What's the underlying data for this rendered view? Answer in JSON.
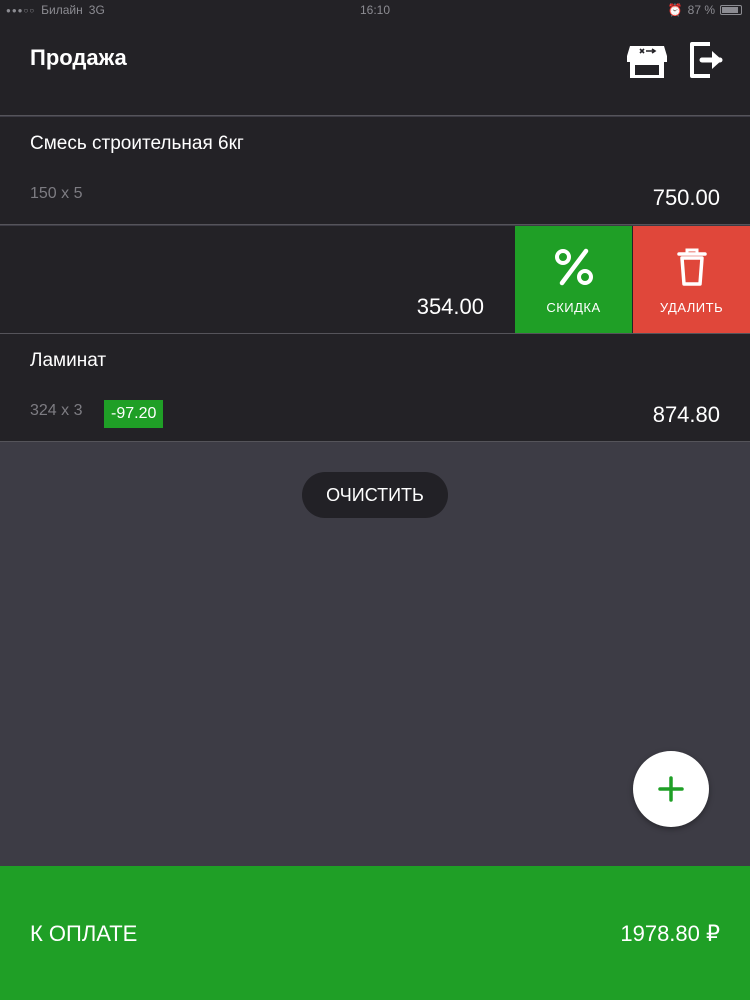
{
  "status_bar": {
    "carrier": "Билайн",
    "network": "3G",
    "time": "16:10",
    "battery": "87 %"
  },
  "header": {
    "title": "Продажа",
    "icons": [
      "store-icon",
      "logout-icon"
    ]
  },
  "items": [
    {
      "name": "Смесь строительная 6кг",
      "qty": "150 x 5",
      "discount": "",
      "total": "750.00"
    },
    {
      "name": "",
      "qty": "",
      "discount": "",
      "total": "354.00"
    },
    {
      "name": "Ламинат",
      "qty": "324 x 3",
      "discount": "-97.20",
      "total": "874.80"
    }
  ],
  "swipe_actions": {
    "discount_label": "СКИДКА",
    "delete_label": "УДАЛИТЬ"
  },
  "clear_label": "ОЧИСТИТЬ",
  "fab_icon": "plus-icon",
  "pay": {
    "label": "К ОПЛАТЕ",
    "amount": "1978.80 ₽"
  },
  "colors": {
    "background": "#3d3c45",
    "panel": "#232226",
    "accent_green": "#1f9f26",
    "delete_red": "#e0473a"
  }
}
